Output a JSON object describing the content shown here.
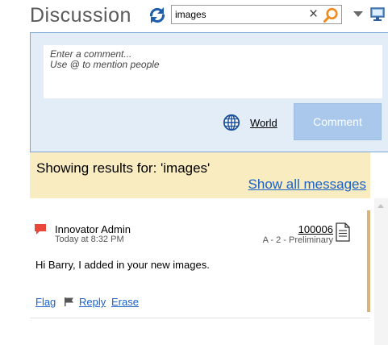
{
  "header": {
    "title": "Discussion",
    "refresh_icon": "refresh-icon",
    "search": {
      "value": "images",
      "clear_glyph": "×"
    },
    "search_icon": "search-icon",
    "dropdown_icon": "chevron-down-icon",
    "monitor_icon": "monitor-icon"
  },
  "compose": {
    "placeholder_line1": "Enter a comment...",
    "placeholder_line2": "Use @ to mention people",
    "visibility_icon": "globe-icon",
    "visibility_label": "World",
    "submit_label": "Comment"
  },
  "results": {
    "text": "Showing results for: 'images'",
    "show_all_label": "Show all messages"
  },
  "messages": [
    {
      "author": "Innovator Admin",
      "timestamp": "Today at 8:32 PM",
      "item_number": "100006",
      "item_revision": "A - 2 - Preliminary",
      "body": "Hi Barry, I added in your new images.",
      "actions": {
        "flag": "Flag",
        "reply": "Reply",
        "erase": "Erase"
      }
    }
  ],
  "colors": {
    "accent_blue": "#1a61c9",
    "compose_bg": "#e3edf8",
    "banner_bg": "#f8ecc0",
    "message_accent": "#dab27a",
    "chat_icon": "#e8473a",
    "search_icon": "#f08a1c",
    "refresh_icon": "#1f5ea8"
  }
}
